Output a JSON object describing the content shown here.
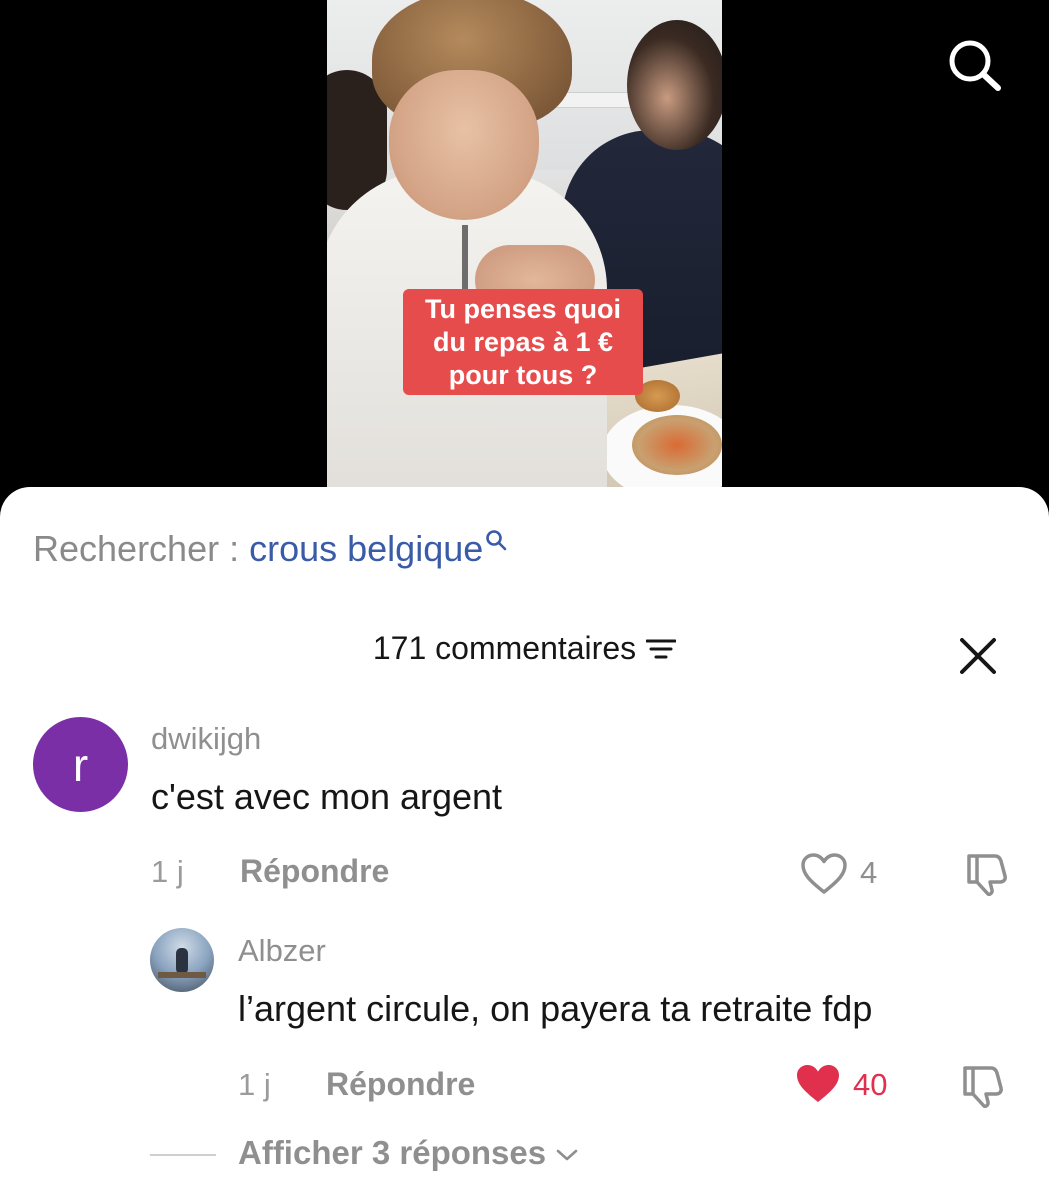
{
  "video": {
    "caption_lines": [
      "Tu penses quoi",
      "du repas à 1 €",
      "pour tous ?"
    ]
  },
  "search_suggestion": {
    "prefix": "Rechercher : ",
    "term": "crous belgique"
  },
  "comments_header": {
    "count_label": "171 commentaires"
  },
  "comments": [
    {
      "avatar_letter": "r",
      "avatar_color": "#7b2fa7",
      "username": "dwikijgh",
      "text": "c'est avec mon argent",
      "time": "1 j",
      "reply_label": "Répondre",
      "likes": "4",
      "liked": false
    }
  ],
  "replies": [
    {
      "username": "Albzer",
      "text": "l’argent circule, on payera ta retraite fdp",
      "time": "1 j",
      "reply_label": "Répondre",
      "likes": "40",
      "liked": true
    }
  ],
  "show_more_replies": "Afficher 3 réponses",
  "colors": {
    "accent_blue": "#3a5ba8",
    "like_red": "#e0304e",
    "caption_bg": "#e74c4c"
  },
  "icons": [
    "search-icon",
    "filter-icon",
    "close-icon",
    "heart-outline-icon",
    "heart-filled-icon",
    "dislike-icon",
    "chevron-down-icon"
  ]
}
